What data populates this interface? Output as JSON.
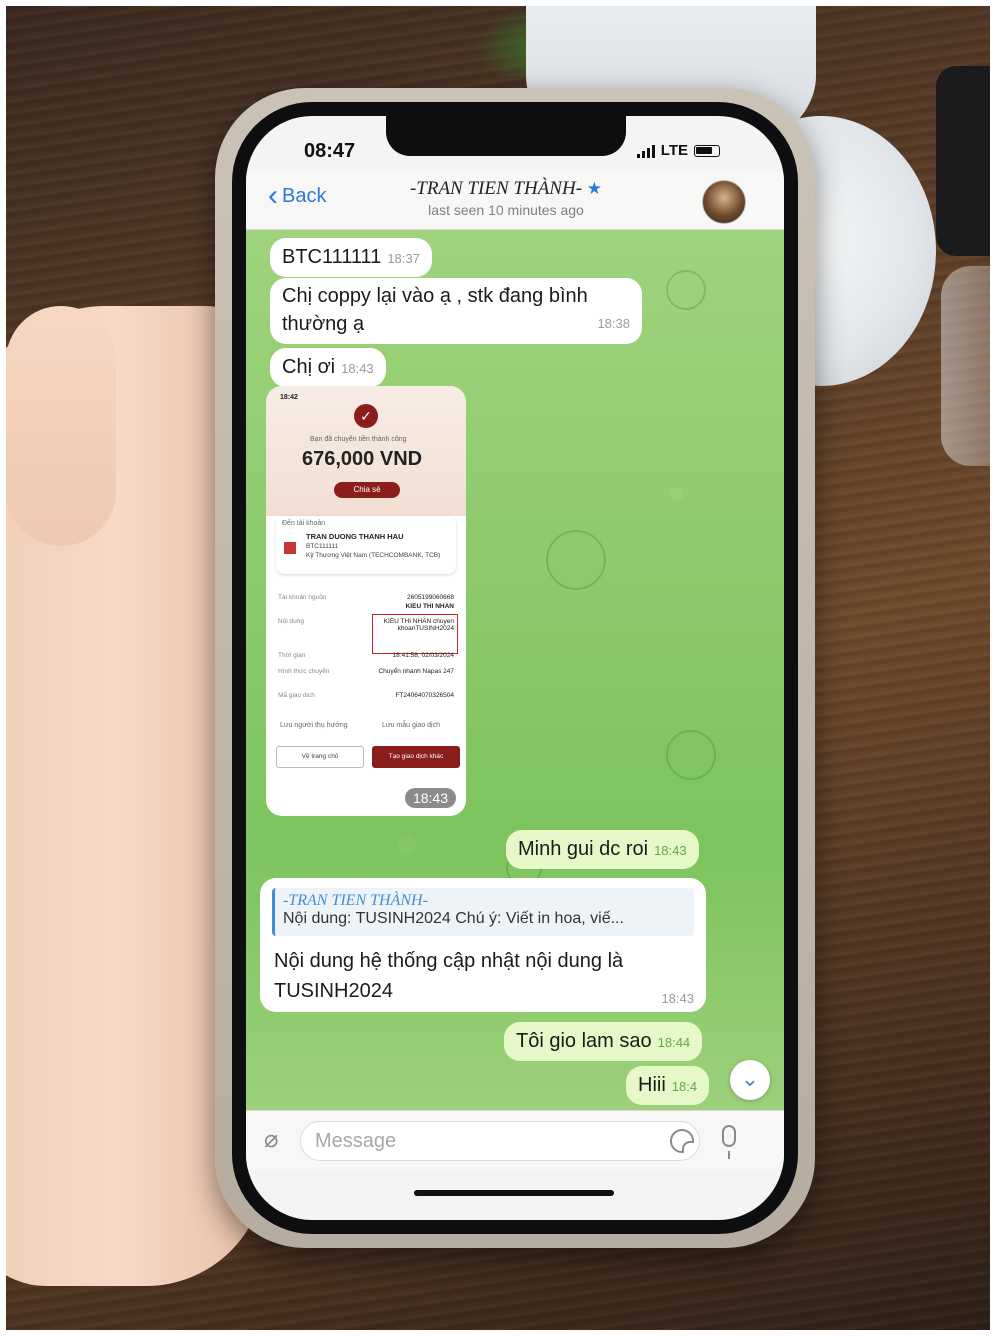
{
  "status_bar": {
    "time": "08:47",
    "network": "LTE"
  },
  "header": {
    "back_label": "Back",
    "contact_name": "-TRAN TIEN THÀNH-",
    "last_seen": "last seen 10 minutes ago"
  },
  "messages": {
    "m1": {
      "text": "BTC111111",
      "time": "18:37"
    },
    "m2": {
      "text_line1": "Chị coppy lại vào ạ , stk đang bình",
      "text_line2": "thường ạ",
      "time": "18:38"
    },
    "m3": {
      "text": "Chị ơi",
      "time": "18:43"
    },
    "receipt": {
      "status_time": "18:42",
      "success_text": "Bạn đã chuyển tiền thành công",
      "amount": "676,000 VND",
      "share_label": "Chia sẻ",
      "to_label": "Đến tài khoản",
      "recipient_name": "TRAN DUONG THANH HAU",
      "recipient_account": "BTC111111",
      "recipient_bank": "Kỹ Thương Việt Nam (TECHCOMBANK, TCB)",
      "source_label": "Tài khoản nguồn",
      "source_value": "2605199060668",
      "source_name": "KIEU THI NHAN",
      "content_label": "Nội dung",
      "content_value": "KIEU THI NHAN chuyen khoanTUSINH2024",
      "time_label": "Thời gian",
      "time_value": "18:41:58, 02/03/2024",
      "method_label": "Hình thức chuyển",
      "method_value": "Chuyển nhanh Napas 247",
      "txn_label": "Mã giao dịch",
      "txn_value": "FT24064070326504",
      "save_recipient": "Lưu người thụ hưởng",
      "save_template": "Lưu mẫu giao dịch",
      "home_btn": "Về trang chủ",
      "new_txn_btn": "Tạo giao dịch khác",
      "bubble_time": "18:43"
    },
    "m4": {
      "text": "Minh gui dc roi",
      "time": "18:43"
    },
    "m5": {
      "reply_name": "-TRAN TIEN THÀNH-",
      "reply_text": "Nội dung: TUSINH2024 Chú ý: Viết in hoa, viế...",
      "text_line1": "Nội dung hệ thống cập nhật nội dung là",
      "text_line2": "TUSINH2024",
      "time": "18:43"
    },
    "m6": {
      "text": "Tôi gio lam sao",
      "time": "18:44"
    },
    "m7": {
      "text": "Hiii",
      "time": "18:4"
    }
  },
  "composer": {
    "placeholder": "Message"
  },
  "icons": {
    "back": "chevron-left-icon",
    "star": "star-icon",
    "attach": "paperclip-icon",
    "sticker": "sticker-icon",
    "mic": "microphone-icon",
    "scroll": "chevron-down-icon"
  },
  "colors": {
    "accent": "#2d7bd6",
    "chat_bg": "#8cca6b",
    "outgoing_bubble": "#e7f8c8",
    "bank_red": "#8b1d1d"
  }
}
